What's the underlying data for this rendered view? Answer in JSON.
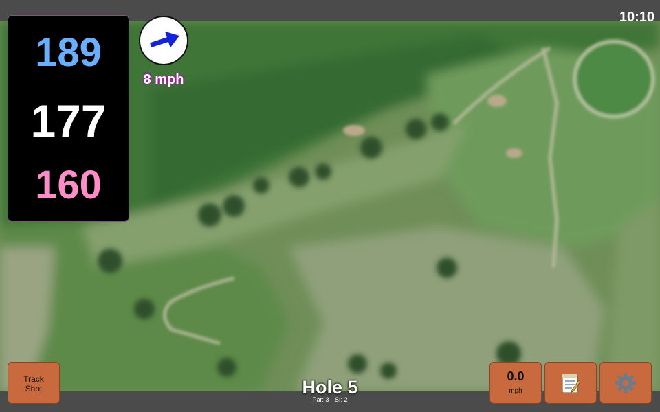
{
  "status_bar": {
    "time": "10:10"
  },
  "distances": {
    "back": "189",
    "middle": "177",
    "front": "160",
    "colors": {
      "back": "#6aaeff",
      "middle": "#ffffff",
      "front": "#ff8ec8"
    }
  },
  "wind": {
    "speed": "8 mph",
    "arrow_color": "#1422d8",
    "icon": "wind-direction-arrow-icon"
  },
  "buttons": {
    "track_shot": "Track\nShot",
    "speed_value": "0.0",
    "speed_unit": "mph",
    "notes_icon": "notepad-icon",
    "settings_icon": "gear-icon",
    "button_color": "#c9693e"
  },
  "hole": {
    "title": "Hole 5",
    "par": "Par: 3",
    "si": "SI: 2"
  }
}
